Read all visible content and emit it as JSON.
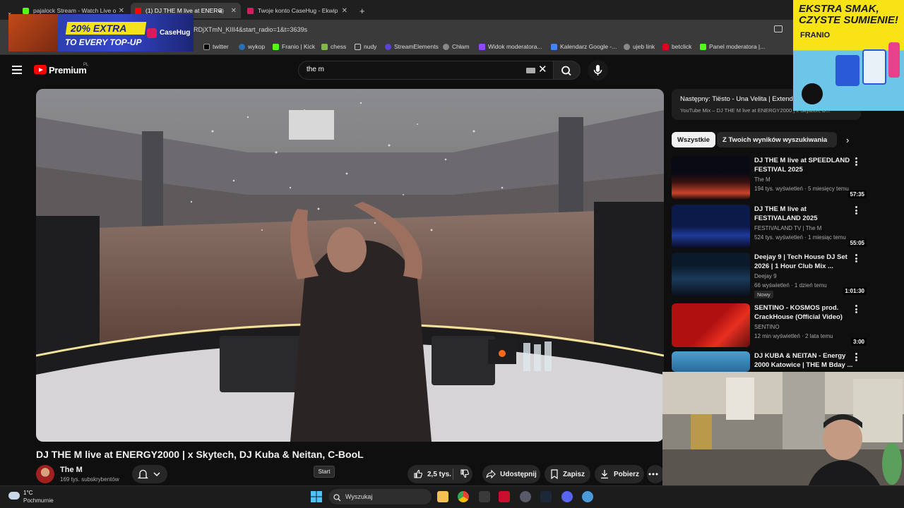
{
  "browser": {
    "tabs": [
      {
        "title": "pajalock Stream - Watch Live o",
        "active": false
      },
      {
        "title": "(1) DJ THE M live at ENERG",
        "active": true
      },
      {
        "title": "Twoje konto CaseHug - Ekwip",
        "active": false
      }
    ],
    "url": "RDjXTmN_KIII4&start_radio=1&t=3639s",
    "bookmarks": [
      "twitter",
      "wykop",
      "Franio | Kick",
      "chess",
      "nudy",
      "StreamElements",
      "Chłam",
      "Widok moderatora...",
      "Kalendarz Google -...",
      "ujeb link",
      "betclick",
      "Panel moderatora |..."
    ]
  },
  "youtube": {
    "brand": "Premium",
    "region": "PL",
    "search_value": "the m"
  },
  "video": {
    "title": "DJ THE M live at ENERGY2000 | x Skytech, DJ Kuba & Neitan, C-BooL",
    "channel_name": "The M",
    "subscribers": "169 tys. subskrybentów",
    "likes": "2,5 tys.",
    "share_label": "Udostępnij",
    "save_label": "Zapisz",
    "download_label": "Pobierz"
  },
  "up_next": {
    "title": "Następny: Tiësto - Una Velita | Extende",
    "subtitle": "YouTube Mix – DJ THE M live at ENERGY2000 | x Skytech, D..."
  },
  "chips": [
    "Wszystkie",
    "Z Twoich wyników wyszukiwania"
  ],
  "recommendations": [
    {
      "title": "DJ THE M live at SPEEDLAND FESTIVAL 2025",
      "channel": "The M",
      "meta": "194 tys. wyświetleń · 5 miesięcy temu",
      "duration": "57:35",
      "badge": ""
    },
    {
      "title": "DJ THE M live at FESTIVALAND 2025",
      "channel": "FESTIVALAND TV | The M",
      "meta": "524 tys. wyświetleń · 1 miesiąc temu",
      "duration": "55:05",
      "badge": ""
    },
    {
      "title": "Deejay 9 | Tech House DJ Set 2026 | 1 Hour Club Mix ...",
      "channel": "Deejay 9",
      "meta": "66 wyświetleń · 1 dzień temu",
      "duration": "1:01:30",
      "badge": "Nowy"
    },
    {
      "title": "SENTINO - KOSMOS prod. CrackHouse (Official Video)",
      "channel": "SENTINO",
      "meta": "12 min wyświetleń · 2 lata temu",
      "duration": "3:00",
      "badge": ""
    },
    {
      "title": "DJ KUBA & NEITAN - Energy 2000 Katowice | THE M Bday ...",
      "channel": "",
      "meta": "",
      "duration": "",
      "badge": ""
    }
  ],
  "overlays": {
    "casehug_offer": "20% EXTRA",
    "casehug_sub": "TO EVERY TOP-UP",
    "casehug_brand": "CaseHug",
    "franio_slogan_1": "EKSTRA SMAK,",
    "franio_slogan_2": "CZYSTE SUMIENIE!",
    "franio_brand": "FRANIO"
  },
  "tooltip": "Start",
  "taskbar": {
    "temperature": "1°C",
    "weather": "Pochmurnie",
    "search_placeholder": "Wyszukaj"
  },
  "colors": {
    "background": "#0f0f0f",
    "youtube_red": "#ff0000",
    "button_bg": "#272727",
    "chip_active_bg": "#f1f1f1"
  }
}
